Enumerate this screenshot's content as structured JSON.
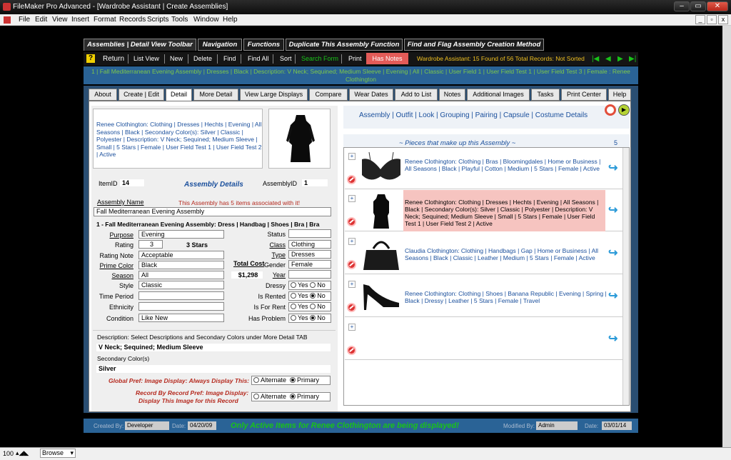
{
  "window": {
    "title": "FileMaker Pro Advanced - [Wardrobe Assistant | Create Assemblies]"
  },
  "menu": [
    "File",
    "Edit",
    "View",
    "Insert",
    "Format",
    "Records",
    "Scripts",
    "Tools",
    "Window",
    "Help"
  ],
  "top_tabs": [
    "Assemblies | Detail View Toolbar",
    "Navigation",
    "Functions",
    "Duplicate This Assembly Function",
    "Find and Flag Assembly Creation Method"
  ],
  "toolbar": {
    "help": "?",
    "return": "Return",
    "list_view": "List View",
    "new": "New",
    "delete": "Delete",
    "find": "Find",
    "find_all": "Find All",
    "sort": "Sort",
    "search_form": "Search Form",
    "print": "Print",
    "has_notes": "Has Notes",
    "status": "Wardrobe Assistant: 15 Found of 56 Total Records: Not Sorted"
  },
  "banner": "1 | Fall Mediterranean Evening Assembly | Dresses | Black | Description: V Neck; Sequined; Medium Sleeve | Evening | All | Classic | User Field 1 | User Field Test 1 | User Field Test 3 | Female : Renee Clothington",
  "tabs": [
    "About",
    "Create | Edit",
    "Detail",
    "More Detail",
    "View Large Displays",
    "Compare",
    "Wear Dates",
    "Add to List",
    "Notes",
    "Additional Images",
    "Tasks",
    "Print Center",
    "Help"
  ],
  "summary_text": "Renee Clothington: Clothing | Dresses | Hechts | Evening | All Seasons | Black | Secondary Color(s): Silver | Classic | Polyester | Description: V Neck; Sequined; Medium Sleeve | Small | 5 Stars | Female | User Field Test 1 | User Field Test 2 | Active",
  "details": {
    "item_id_label": "ItemID",
    "item_id": "14",
    "heading": "Assembly Details",
    "assembly_id_label": "AssemblyID",
    "assembly_id": "1",
    "assembly_name_label": "Assembly Name",
    "assoc_msg_pre": "This Assembly has ",
    "assoc_count": "5",
    "assoc_msg_post": " items associated with it!",
    "assembly_name": "Fall Mediterranean Evening Assembly",
    "assembly_line": "1 - Fall Mediterranean Evening Assembly: Dress | Handbag | Shoes | Bra | Bra",
    "purpose_label": "Purpose",
    "purpose": "Evening",
    "rating_label": "Rating",
    "rating": "3",
    "rating_stars": "3 Stars",
    "rating_note_label": "Rating Note",
    "rating_note": "Acceptable",
    "prime_color_label": "Prime Color",
    "prime_color": "Black",
    "season_label": "Season",
    "season": "All",
    "style_label": "Style",
    "style": "Classic",
    "time_period_label": "Time Period",
    "time_period": "",
    "ethnicity_label": "Ethnicity",
    "ethnicity": "",
    "condition_label": "Condition",
    "condition": "Like New",
    "total_cost_label": "Total Cost",
    "total_cost": "$1,298",
    "status_label": "Status",
    "status": "",
    "class_label": "Class",
    "class": "Clothing",
    "type_label": "Type",
    "type": "Dresses",
    "gender_label": "Gender",
    "gender": "Female",
    "year_label": "Year",
    "year": "",
    "dressy_label": "Dressy",
    "is_rented_label": "Is Rented",
    "is_for_rent_label": "Is For Rent",
    "has_problem_label": "Has Problem",
    "yes": "Yes",
    "no": "No"
  },
  "description": {
    "label": "Description: Select Descriptions and Secondary Colors under More Detail TAB",
    "value": "V Neck; Sequined; Medium Sleeve",
    "secondary_label": "Secondary Color(s)",
    "secondary_value": "Silver"
  },
  "prefs": {
    "global_label": "Global Pref: Image Display: Always Display This:",
    "record_label1": "Record By Record Pref: Image Display:",
    "record_label2": "Display This Image for this Record",
    "alternate": "Alternate",
    "primary": "Primary"
  },
  "links": "Assembly | Outfit | Look | Grouping | Pairing | Capsule | Costume Details",
  "pieces": {
    "title": "~  Pieces that make up this Assembly  ~",
    "count": "5",
    "plus": "+"
  },
  "items": [
    {
      "text": "Renee Clothington: Clothing | Bras | Bloomingdales | Home or Business | All Seasons | Black | Playful | Cotton | Medium | 5 Stars | Female | Active"
    },
    {
      "text": "Renee Clothington: Clothing | Dresses | Hechts | Evening | All Seasons | Black | Secondary Color(s): Silver | Classic | Polyester | Description: V Neck; Sequined; Medium Sleeve | Small | 5 Stars | Female | User Field Test 1 | User Field Test 2 | Active"
    },
    {
      "text": "Claudia Clothington: Clothing | Handbags | Gap | Home or Business | All Seasons | Black | Classic | Leather | Medium | 5 Stars | Female | Active"
    },
    {
      "text": "Renee Clothington: Clothing | Shoes | Banana Republic | Evening | Spring | Black | Dressy | Leather | 5 Stars | Female | Travel"
    },
    {
      "text": ""
    }
  ],
  "status_bar": {
    "created_by_label": "Created By:",
    "created_by": "Developer",
    "date_label": "Date:",
    "created_date": "04/20/09",
    "message": "Only Active Items for Renee Clothington are being displayed!",
    "modified_by_label": "Modified By:",
    "modified_by": "Admin",
    "modified_date": "03/01/14"
  },
  "bottom": {
    "zoom": "100",
    "mode": "Browse"
  },
  "colors": {
    "accent_red": "#b52a1f",
    "highlight_row": "#f6c4c0",
    "nav_green": "#19c219",
    "banner_blue": "#2a6396"
  }
}
